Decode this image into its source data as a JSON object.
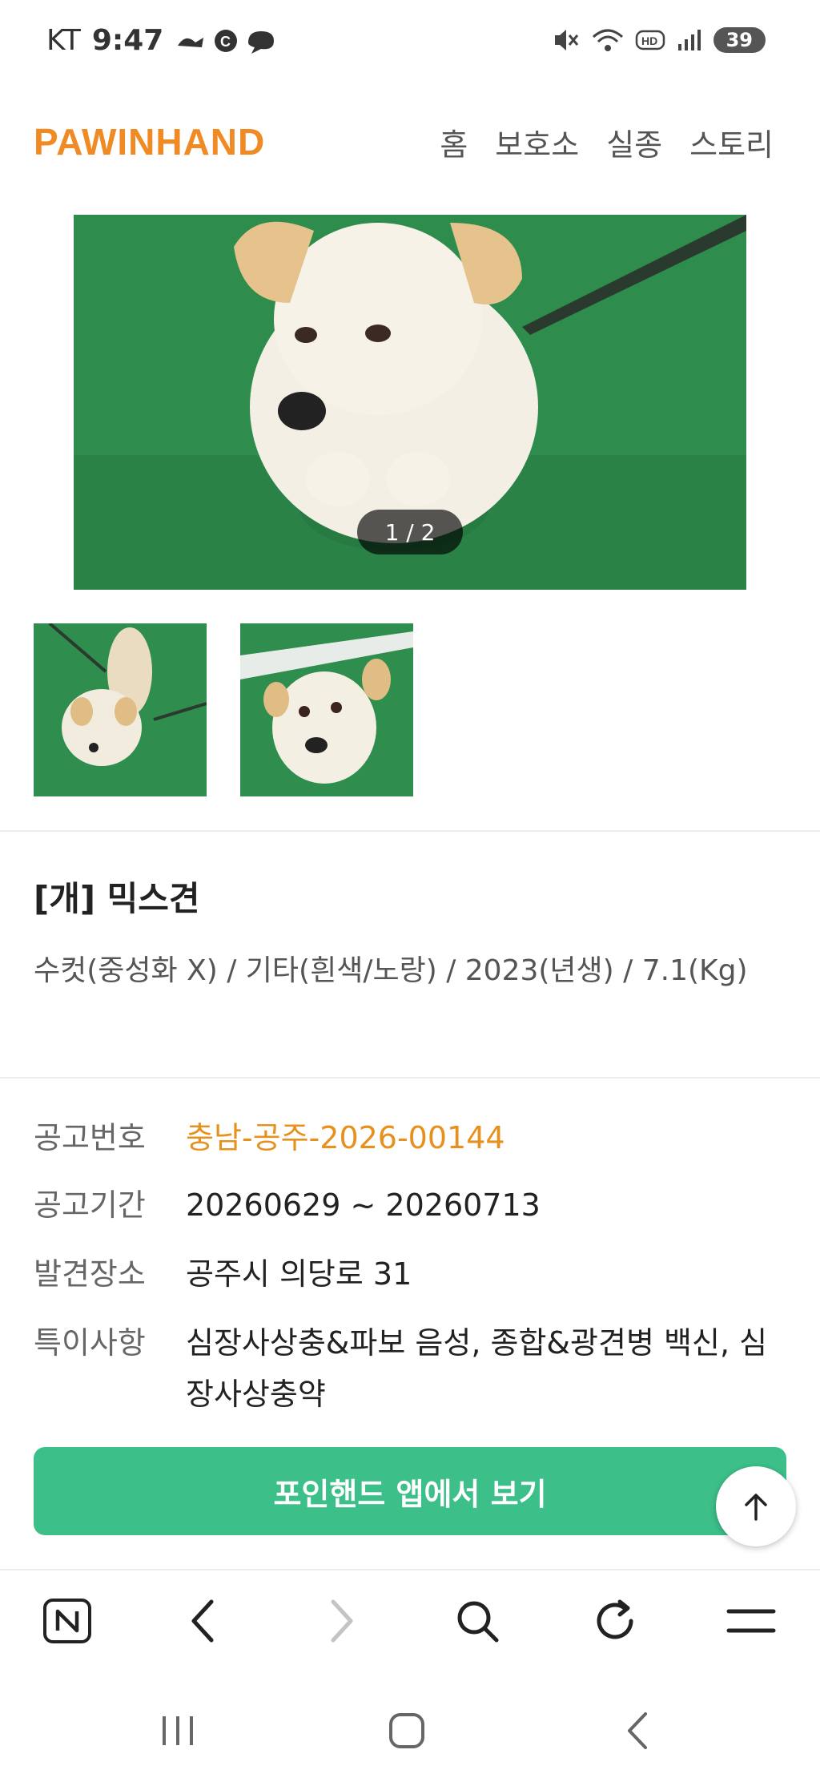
{
  "status_bar": {
    "carrier": "KT",
    "time": "9:47",
    "battery": "39"
  },
  "header": {
    "logo": "PAWINHAND",
    "nav": [
      "홈",
      "보호소",
      "실종",
      "스토리"
    ]
  },
  "gallery": {
    "pager": "1 / 2"
  },
  "animal": {
    "title": "[개] 믹스견",
    "description": "수컷(중성화 X) / 기타(흰색/노랑) / 2023(년생) / 7.1(Kg)"
  },
  "info": [
    {
      "label": "공고번호",
      "value": "충남-공주-2026-00144"
    },
    {
      "label": "공고기간",
      "value": "20260629 ~ 20260713"
    },
    {
      "label": "발견장소",
      "value": "공주시 의당로 31"
    },
    {
      "label": "특이사항",
      "value": "심장사상충&파보 음성, 종합&광견병 백신, 심장사상충약"
    }
  ],
  "app_button": "포인핸드 앱에서 보기",
  "colors": {
    "brand": "#f08a24",
    "accent_green": "#3dbf89",
    "notice_orange": "#e8901e"
  },
  "icons": {
    "toolbar": [
      "naver-n-icon",
      "back-arrow-icon",
      "forward-arrow-icon",
      "search-icon",
      "refresh-icon",
      "menu-icon"
    ],
    "system": [
      "recent-apps-icon",
      "home-icon",
      "back-icon"
    ]
  }
}
